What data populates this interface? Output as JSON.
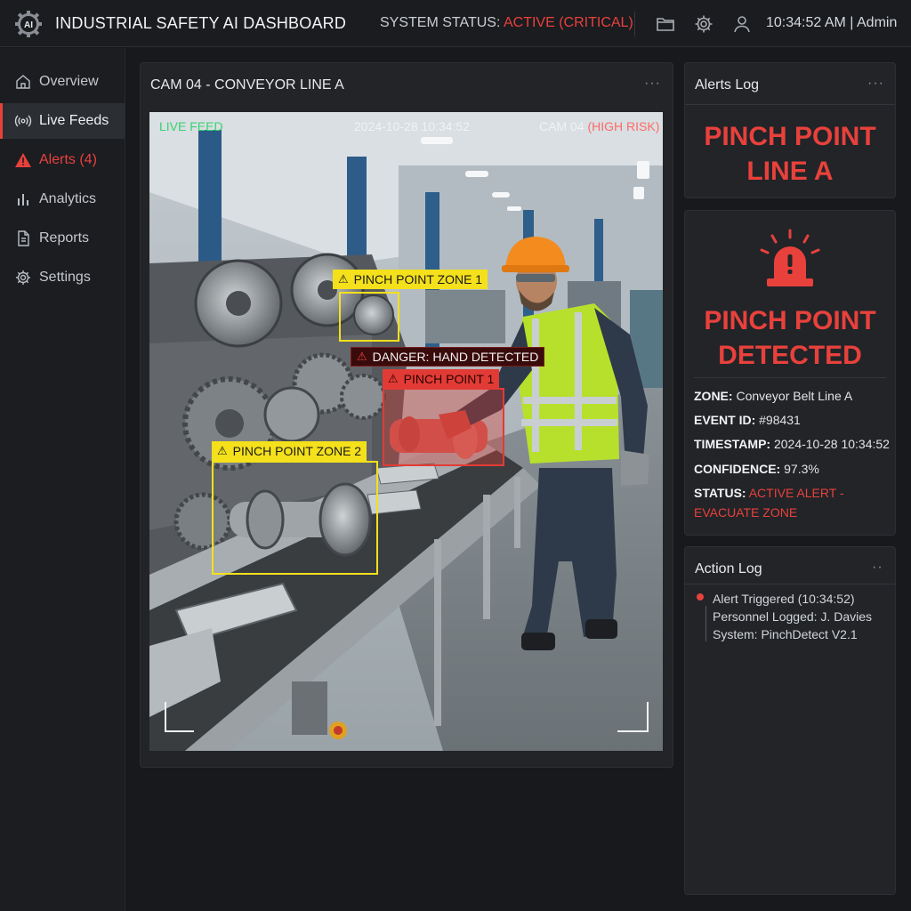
{
  "header": {
    "logo_text": "AI",
    "title": "INDUSTRIAL SAFETY AI DASHBOARD",
    "status_label": "SYSTEM STATUS:",
    "status_value": "ACTIVE (CRITICAL)",
    "time_user": "10:34:52 AM | Admin",
    "icons": [
      "folder-icon",
      "gear-icon",
      "user-icon"
    ]
  },
  "sidebar": {
    "items": [
      {
        "label": "Overview",
        "icon": "home-icon"
      },
      {
        "label": "Live Feeds",
        "icon": "broadcast-icon",
        "active": true
      },
      {
        "label": "Alerts (4)",
        "icon": "warning-icon",
        "alert": true
      },
      {
        "label": "Analytics",
        "icon": "bar-chart-icon"
      },
      {
        "label": "Reports",
        "icon": "document-icon"
      },
      {
        "label": "Settings",
        "icon": "gear-icon"
      }
    ]
  },
  "camera": {
    "title": "CAM 04 - CONVEYOR LINE A",
    "menu": "···",
    "live_label": "LIVE FEED",
    "timestamp": "2024-10-28 10:34:52",
    "cam_id": "CAM 04",
    "risk": "(HIGH RISK)",
    "detections": {
      "zone1": "PINCH POINT ZONE 1",
      "danger": "DANGER: HAND DETECTED",
      "point1": "PINCH POINT 1",
      "zone2": "PINCH POINT ZONE 2"
    }
  },
  "alerts_log": {
    "title": "Alerts Log",
    "menu": "···",
    "headline_line1": "PINCH POINT",
    "headline_line2": "LINE A"
  },
  "alert_detail": {
    "headline_line1": "PINCH POINT",
    "headline_line2": "DETECTED",
    "zone_label": "ZONE:",
    "zone_value": "Conveyor Belt Line A",
    "event_label": "EVENT ID:",
    "event_value": "#98431",
    "timestamp_label": "TIMESTAMP:",
    "timestamp_value": "2024-10-28 10:34:52",
    "confidence_label": "CONFIDENCE:",
    "confidence_value": "97.3%",
    "status_label": "STATUS:",
    "status_value_line1": "ACTIVE ALERT -",
    "status_value_line2": "EVACUATE ZONE"
  },
  "action_log": {
    "title": "Action Log",
    "menu": "··",
    "entries": [
      "Alert Triggered (10:34:52)",
      "Personnel Logged: J. Davies",
      "System: PinchDetect V2.1"
    ]
  },
  "colors": {
    "critical": "#e8413c",
    "detection_yellow": "#f4e01b",
    "live_green": "#3bd16f",
    "background": "#17191c",
    "panel": "#222428"
  }
}
